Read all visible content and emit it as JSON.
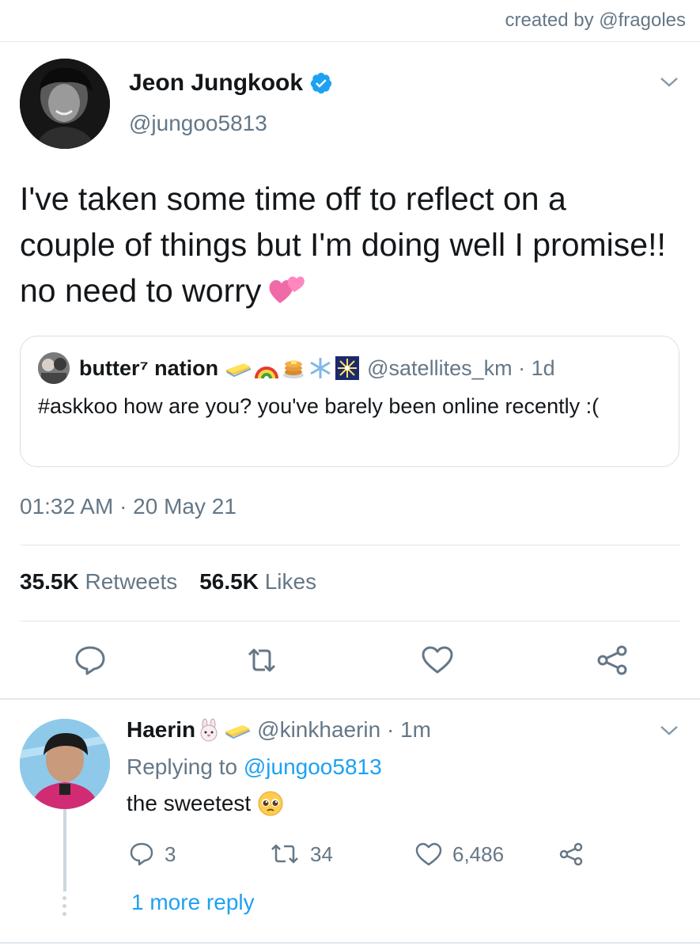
{
  "credit": "created by @fragoles",
  "tweet": {
    "author_name": "Jeon Jungkook",
    "author_handle": "@jungoo5813",
    "text": "I've taken some time off to reflect on a couple of things but I'm doing well I promise!! no need to worry",
    "text_emoji": "two-hearts-emoji",
    "timestamp": "01:32 AM · 20 May 21",
    "retweets_count": "35.5K",
    "retweets_label": "Retweets",
    "likes_count": "56.5K",
    "likes_label": "Likes",
    "accent_color": "#1da1f2"
  },
  "quote": {
    "name": "butter⁷ nation",
    "name_emojis": [
      "butter-emoji",
      "rainbow-emoji",
      "pancakes-emoji",
      "snowflake-emoji",
      "sparkler-emoji"
    ],
    "handle_time": "@satellites_km · 1d",
    "text": "#askkoo how are you? you've barely been online recently :("
  },
  "reply": {
    "name": "Haerin",
    "name_emojis": [
      "rabbit-face-emoji",
      "butter-emoji"
    ],
    "handle_time": "@kinkhaerin · 1m",
    "replying_label": "Replying to",
    "replying_handle": "@jungoo5813",
    "text": "the sweetest",
    "text_emoji": "pleading-face-emoji",
    "reply_count": "3",
    "retweet_count": "34",
    "like_count": "6,486",
    "more_replies": "1 more reply"
  }
}
